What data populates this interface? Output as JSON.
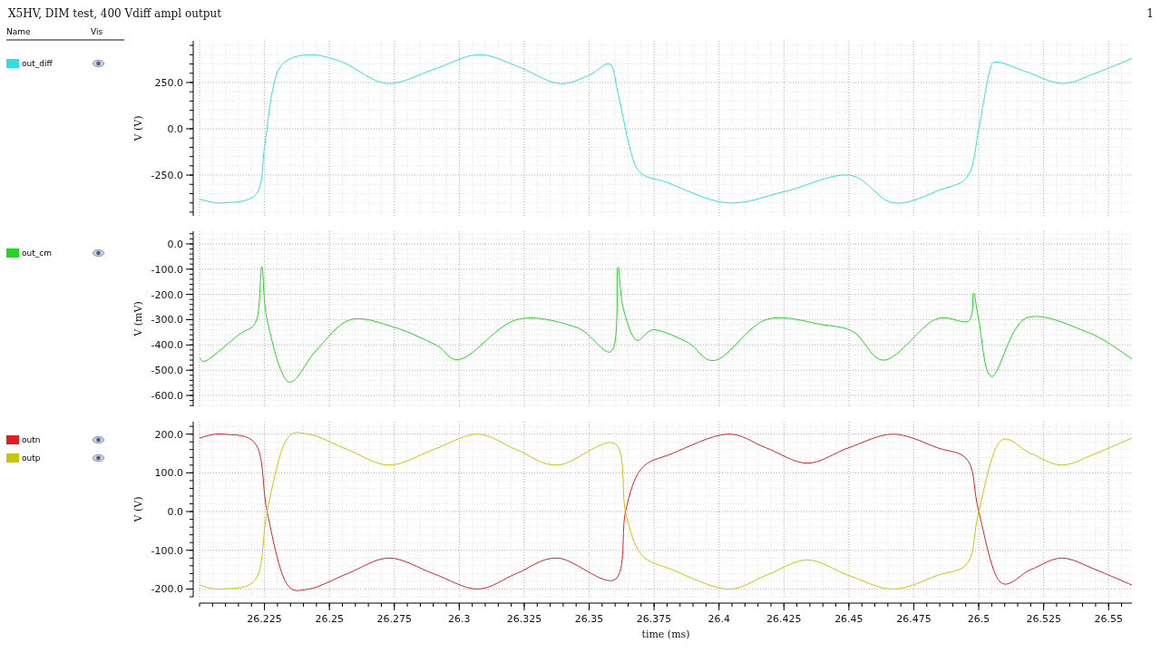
{
  "title": "X5HV, DIM test, 400 Vdiff ampl output",
  "page_number": "1",
  "legend_header": {
    "name": "Name",
    "vis": "Vis"
  },
  "panels": [
    {
      "chart_data": {
        "type": "line",
        "grid": true,
        "ylabel": "V (V)",
        "xlim": [
          26.2,
          26.559
        ],
        "ylim": [
          -470,
          475
        ],
        "yticks": [
          {
            "value": -250,
            "label": "-250.0"
          },
          {
            "value": 0,
            "label": "0.0"
          },
          {
            "value": 250,
            "label": "250.0"
          }
        ],
        "x": [
          26.2,
          26.209,
          26.222,
          26.225,
          26.228,
          26.232,
          26.242,
          26.255,
          26.272,
          26.29,
          26.307,
          26.322,
          26.338,
          26.35,
          26.358,
          26.361,
          26.366,
          26.37,
          26.38,
          26.403,
          26.425,
          26.45,
          26.467,
          26.485,
          26.496,
          26.5,
          26.504,
          26.507,
          26.518,
          26.532,
          26.545,
          26.559
        ],
        "series": [
          {
            "name": "out_diff",
            "color": "#30e0e0",
            "values": [
              -380,
              -400,
              -350,
              -100,
              200,
              350,
              400,
              360,
              245,
              320,
              400,
              340,
              245,
              290,
              350,
              200,
              -120,
              -240,
              -290,
              -400,
              -340,
              -250,
              -400,
              -330,
              -250,
              0,
              300,
              360,
              310,
              245,
              300,
              380
            ]
          }
        ]
      }
    },
    {
      "chart_data": {
        "type": "line",
        "grid": true,
        "ylabel": "V (mV)",
        "xlim": [
          26.2,
          26.559
        ],
        "ylim": [
          -643,
          50
        ],
        "yticks": [
          {
            "value": -600,
            "label": "-600.0"
          },
          {
            "value": -500,
            "label": "-500.0"
          },
          {
            "value": -400,
            "label": "-400.0"
          },
          {
            "value": -300,
            "label": "-300.0"
          },
          {
            "value": -200,
            "label": "-200.0"
          },
          {
            "value": -100,
            "label": "-100.0"
          },
          {
            "value": 0,
            "label": "0.0"
          }
        ],
        "x": [
          26.2,
          26.203,
          26.215,
          26.222,
          26.224,
          26.226,
          26.234,
          26.245,
          26.258,
          26.275,
          26.291,
          26.301,
          26.322,
          26.345,
          26.359,
          26.361,
          26.363,
          26.368,
          26.375,
          26.388,
          26.399,
          26.418,
          26.44,
          26.452,
          26.464,
          26.483,
          26.496,
          26.498,
          26.5,
          26.505,
          26.518,
          26.542,
          26.559
        ],
        "series": [
          {
            "name": "out_cm",
            "color": "#20d820",
            "values": [
              -450,
              -460,
              -360,
              -300,
              -90,
              -300,
              -545,
              -420,
              -300,
              -330,
              -400,
              -455,
              -300,
              -330,
              -420,
              -95,
              -250,
              -380,
              -340,
              -390,
              -460,
              -300,
              -320,
              -350,
              -460,
              -300,
              -305,
              -195,
              -300,
              -525,
              -295,
              -350,
              -455
            ]
          }
        ]
      }
    },
    {
      "chart_data": {
        "type": "line",
        "grid": true,
        "xlabel": "time (ms)",
        "ylabel": "V (V)",
        "xlim": [
          26.2,
          26.559
        ],
        "ylim": [
          -220,
          232
        ],
        "yticks": [
          {
            "value": -200,
            "label": "-200.0"
          },
          {
            "value": -100,
            "label": "-100.0"
          },
          {
            "value": 0,
            "label": "0.0"
          },
          {
            "value": 100,
            "label": "100.0"
          },
          {
            "value": 200,
            "label": "200.0"
          }
        ],
        "xticks": [
          26.225,
          26.25,
          26.275,
          26.3,
          26.325,
          26.35,
          26.375,
          26.4,
          26.425,
          26.45,
          26.475,
          26.5,
          26.525,
          26.55
        ],
        "x": [
          26.2,
          26.209,
          26.222,
          26.226,
          26.233,
          26.242,
          26.257,
          26.273,
          26.29,
          26.307,
          26.322,
          26.338,
          26.36,
          26.364,
          26.37,
          26.382,
          26.403,
          26.418,
          26.434,
          26.45,
          26.467,
          26.484,
          26.496,
          26.5,
          26.508,
          26.52,
          26.532,
          26.545,
          26.559
        ],
        "series": [
          {
            "name": "outn",
            "color": "#e02020",
            "values": [
              190,
              200,
              170,
              0,
              -180,
              -200,
              -160,
              -120,
              -160,
              -200,
              -160,
              -120,
              -175,
              0,
              110,
              150,
              200,
              165,
              125,
              165,
              200,
              165,
              130,
              0,
              -180,
              -150,
              -120,
              -150,
              -190
            ]
          },
          {
            "name": "outp",
            "color": "#c8c800",
            "values": [
              -190,
              -200,
              -170,
              0,
              180,
              200,
              160,
              120,
              160,
              200,
              160,
              120,
              175,
              0,
              -110,
              -150,
              -200,
              -165,
              -125,
              -165,
              -200,
              -165,
              -130,
              0,
              180,
              150,
              120,
              150,
              190
            ]
          }
        ]
      }
    }
  ]
}
